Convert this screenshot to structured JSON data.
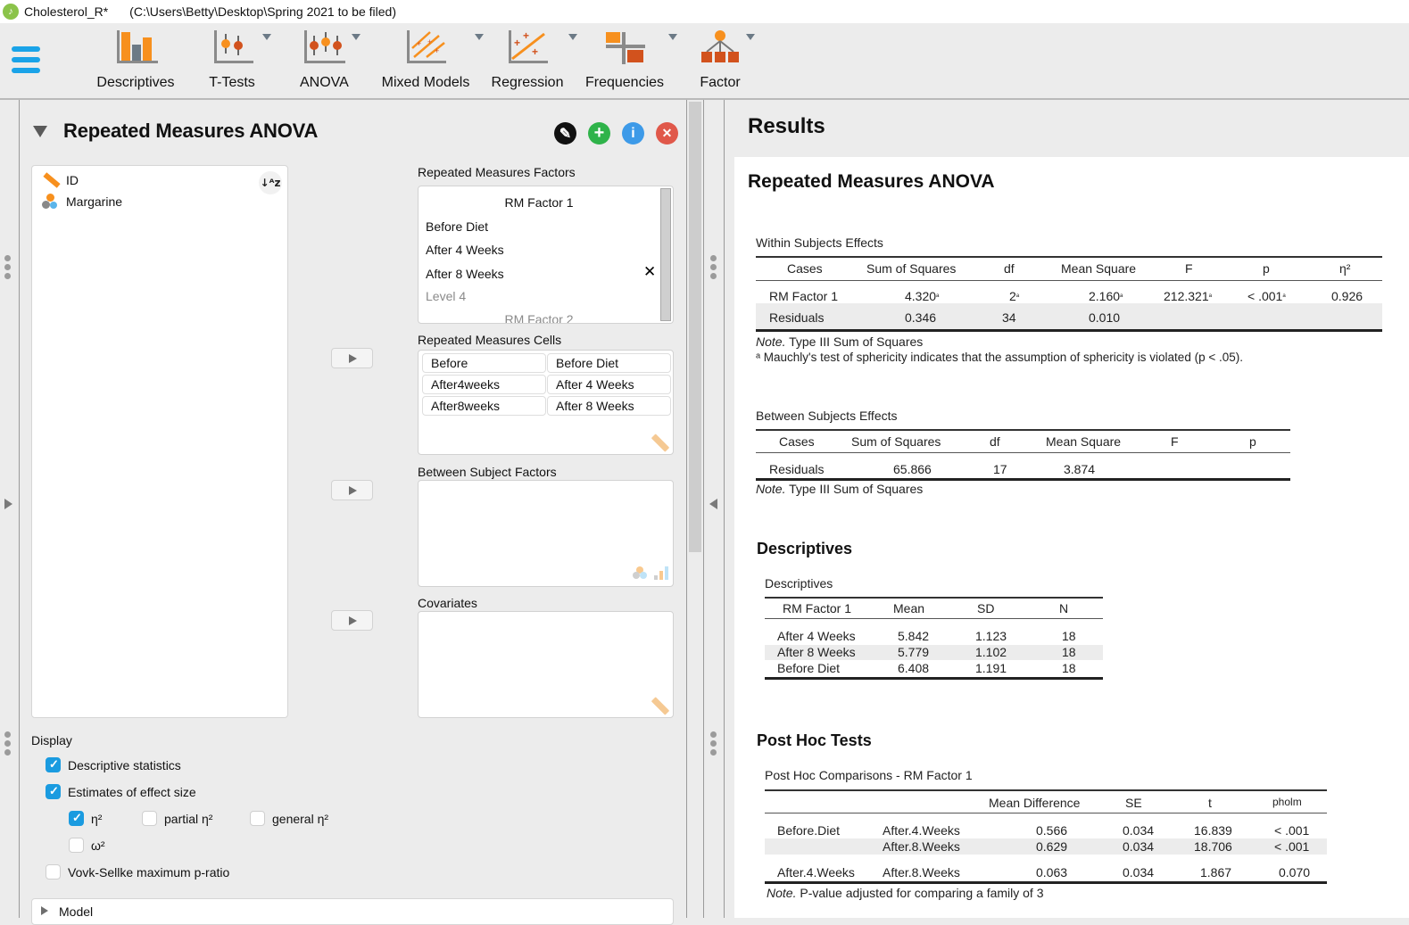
{
  "window": {
    "app_name": "Cholesterol_R*",
    "path": "(C:\\Users\\Betty\\Desktop\\Spring 2021 to be filed)"
  },
  "ribbon": {
    "menu_icon": "hamburger-icon",
    "buttons": [
      {
        "label": "Descriptives",
        "icon": "descriptives-icon",
        "dropdown": false
      },
      {
        "label": "T-Tests",
        "icon": "t-tests-icon",
        "dropdown": true
      },
      {
        "label": "ANOVA",
        "icon": "anova-icon",
        "dropdown": true
      },
      {
        "label": "Mixed Models",
        "icon": "mixed-models-icon",
        "dropdown": true
      },
      {
        "label": "Regression",
        "icon": "regression-icon",
        "dropdown": true
      },
      {
        "label": "Frequencies",
        "icon": "frequencies-icon",
        "dropdown": true
      },
      {
        "label": "Factor",
        "icon": "factor-icon",
        "dropdown": true
      }
    ]
  },
  "analysis": {
    "title": "Repeated Measures ANOVA",
    "header_buttons": [
      {
        "name": "edit-title",
        "icon": "pencil-icon",
        "glyph": "✎",
        "color": "#111111"
      },
      {
        "name": "duplicate",
        "icon": "plus-icon",
        "glyph": "+",
        "color": "#2fb34a"
      },
      {
        "name": "info",
        "icon": "info-icon",
        "glyph": "i",
        "color": "#3d9ae8"
      },
      {
        "name": "close",
        "icon": "close-icon",
        "glyph": "✕",
        "color": "#e0584a"
      }
    ],
    "variables": [
      {
        "name": "ID",
        "type": "scale"
      },
      {
        "name": "Margarine",
        "type": "nominal"
      }
    ],
    "sort_label": "↓ᴬz",
    "rm_factors": {
      "label": "Repeated Measures Factors",
      "factor_name": "RM Factor 1",
      "levels": [
        "Before Diet",
        "After 4 Weeks",
        "After 8 Weeks"
      ],
      "placeholder_level": "Level 4",
      "next_factor_placeholder": "RM Factor 2"
    },
    "rm_cells": {
      "label": "Repeated Measures Cells",
      "rows": [
        {
          "variable": "Before",
          "level": "Before Diet"
        },
        {
          "variable": "After4weeks",
          "level": "After 4 Weeks"
        },
        {
          "variable": "After8weeks",
          "level": "After 8 Weeks"
        }
      ]
    },
    "between_subject_factors": {
      "label": "Between Subject Factors"
    },
    "covariates": {
      "label": "Covariates"
    },
    "display": {
      "label": "Display",
      "options": [
        {
          "label": "Descriptive statistics",
          "checked": true
        },
        {
          "label": "Estimates of effect size",
          "checked": true
        },
        {
          "label": "η²",
          "checked": true
        },
        {
          "label": "partial η²",
          "checked": false
        },
        {
          "label": "general η²",
          "checked": false
        },
        {
          "label": "ω²",
          "checked": false
        },
        {
          "label": "Vovk-Sellke maximum p-ratio",
          "checked": false
        }
      ]
    },
    "model_section": "Model"
  },
  "results": {
    "title": "Results",
    "analysis_title": "Repeated Measures ANOVA",
    "within": {
      "caption": "Within Subjects Effects",
      "headers": [
        "Cases",
        "Sum of Squares",
        "df",
        "Mean Square",
        "F",
        "p",
        "η²"
      ],
      "rows": [
        [
          "RM Factor 1",
          "4.320",
          "2",
          "2.160",
          "212.321",
          "< .001",
          "0.926"
        ],
        [
          "Residuals",
          "0.346",
          "34",
          "0.010",
          "",
          "",
          ""
        ]
      ],
      "footnote_mark": "ᵃ",
      "note_label": "Note.",
      "note_text": " Type III Sum of Squares",
      "footnote": "ᵃ Mauchly's test of sphericity indicates that the assumption of sphericity is violated (p < .05)."
    },
    "between": {
      "caption": "Between Subjects Effects",
      "headers": [
        "Cases",
        "Sum of Squares",
        "df",
        "Mean Square",
        "F",
        "p"
      ],
      "rows": [
        [
          "Residuals",
          "65.866",
          "17",
          "3.874",
          "",
          ""
        ]
      ],
      "note_label": "Note.",
      "note_text": " Type III Sum of Squares"
    },
    "descriptives": {
      "heading": "Descriptives",
      "caption": "Descriptives",
      "headers": [
        "RM Factor 1",
        "Mean",
        "SD",
        "N"
      ],
      "rows": [
        [
          "After 4 Weeks",
          "5.842",
          "1.123",
          "18"
        ],
        [
          "After 8 Weeks",
          "5.779",
          "1.102",
          "18"
        ],
        [
          "Before Diet",
          "6.408",
          "1.191",
          "18"
        ]
      ]
    },
    "posthoc": {
      "heading": "Post Hoc Tests",
      "caption": "Post Hoc Comparisons - RM Factor 1",
      "headers": [
        "",
        "",
        "Mean Difference",
        "SE",
        "t",
        "pholm"
      ],
      "rows": [
        [
          "Before.Diet",
          "After.4.Weeks",
          "0.566",
          "0.034",
          "16.839",
          "< .001"
        ],
        [
          "",
          "After.8.Weeks",
          "0.629",
          "0.034",
          "18.706",
          "< .001"
        ],
        [
          "After.4.Weeks",
          "After.8.Weeks",
          "0.063",
          "0.034",
          "1.867",
          "0.070"
        ]
      ],
      "note_label": "Note.",
      "note_text": " P-value adjusted for comparing a family of 3"
    }
  }
}
